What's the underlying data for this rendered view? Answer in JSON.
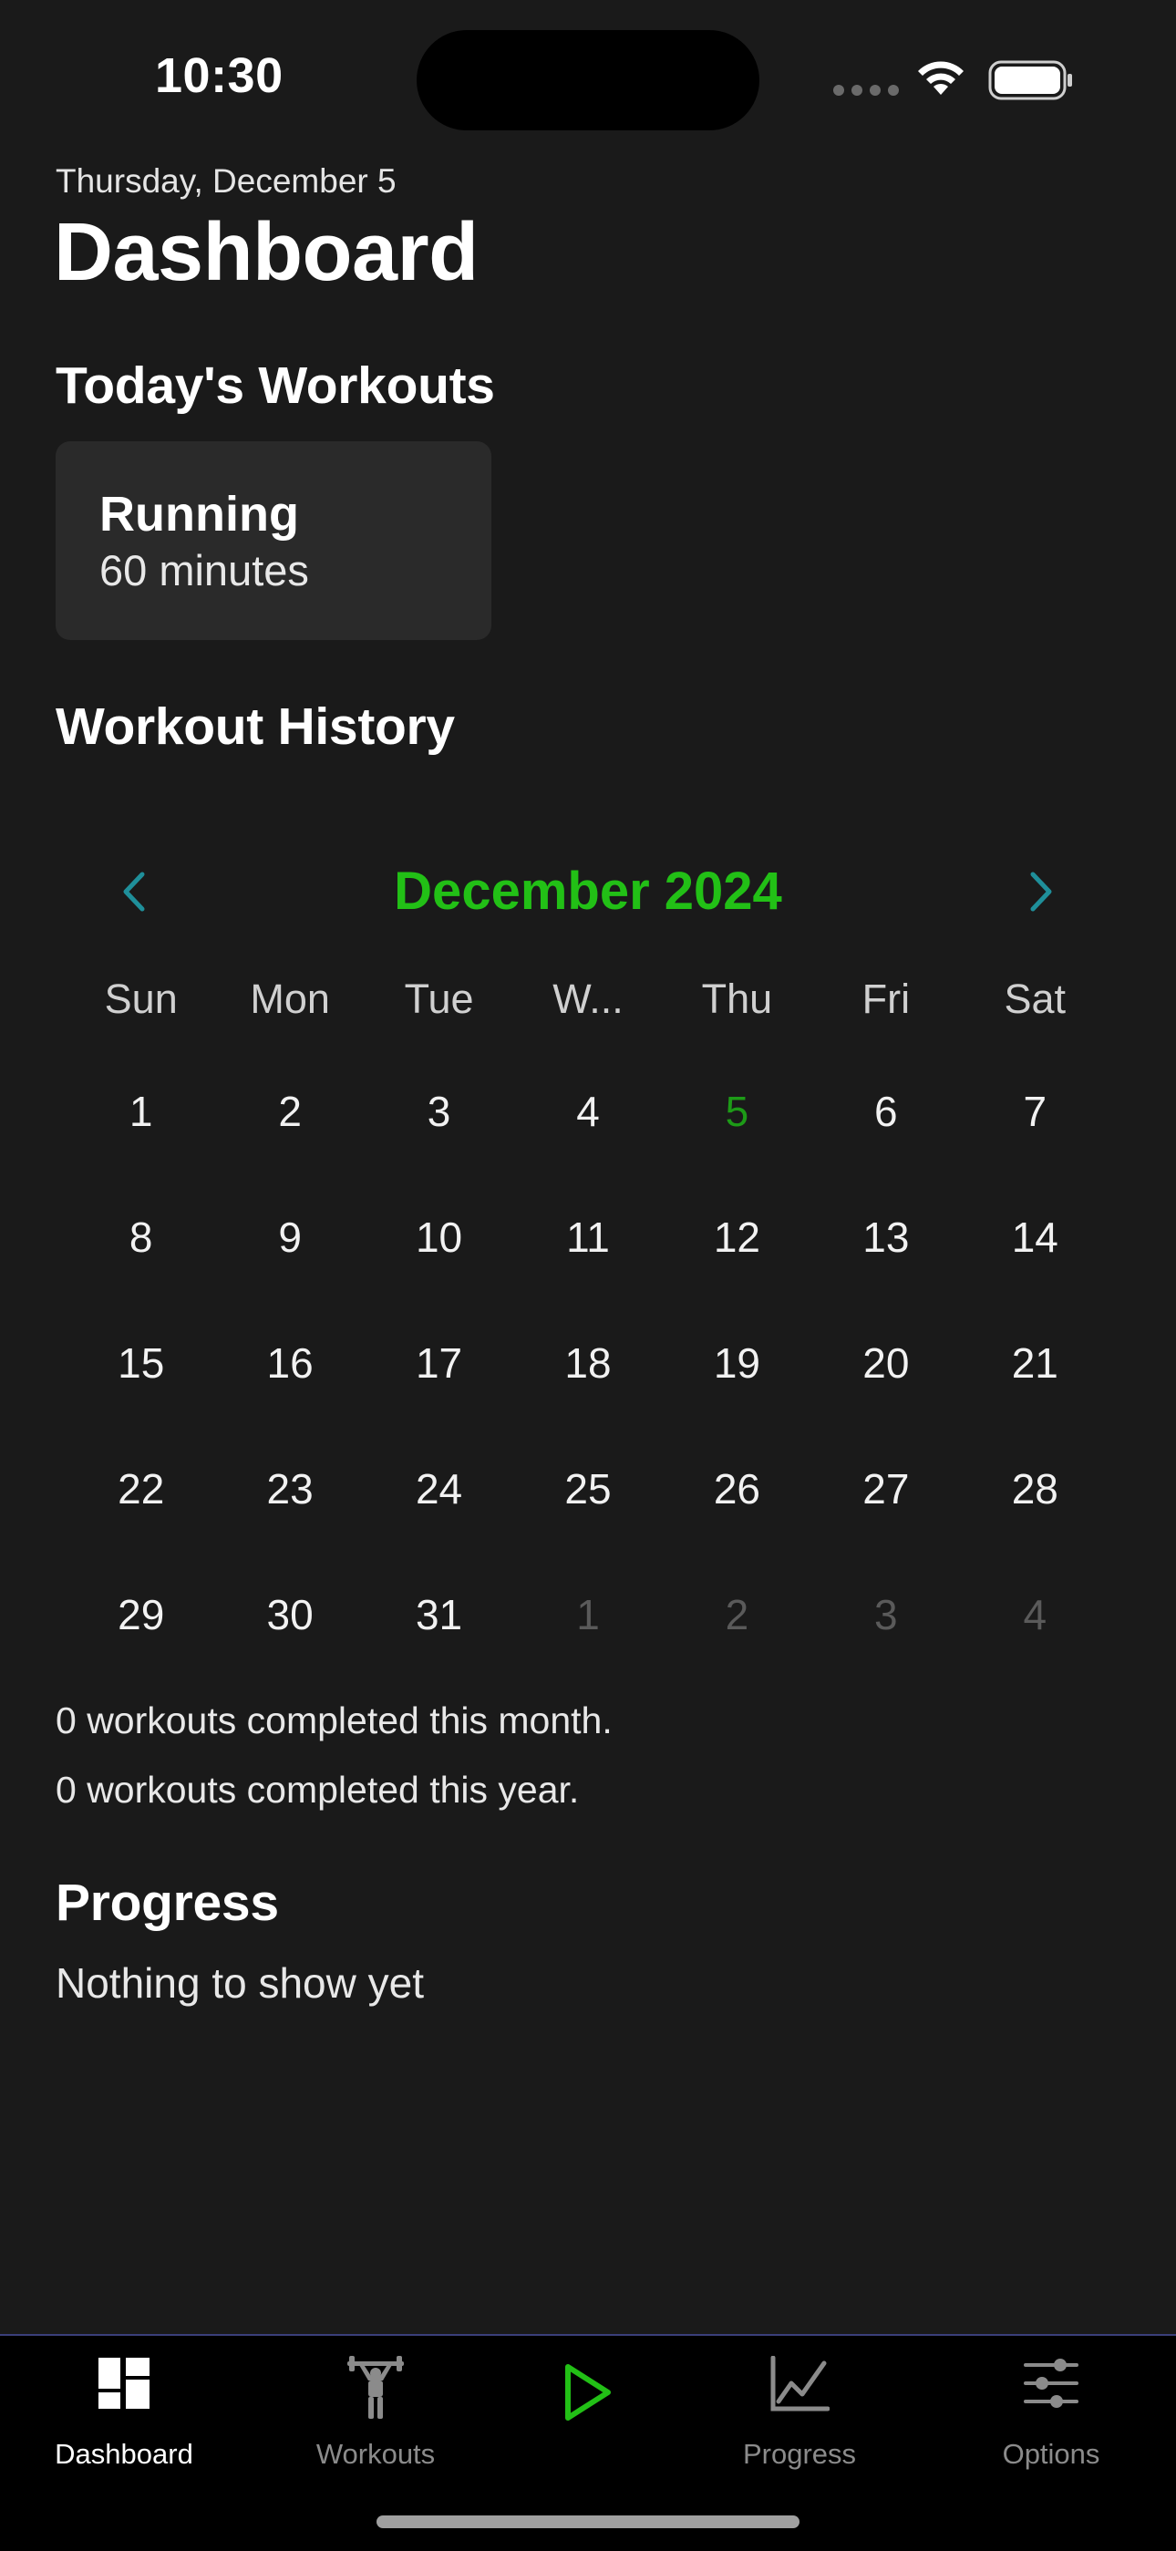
{
  "status_bar": {
    "time": "10:30"
  },
  "header": {
    "date": "Thursday, December 5",
    "title": "Dashboard"
  },
  "todays_workouts": {
    "title": "Today's Workouts",
    "items": [
      {
        "name": "Running",
        "duration": "60 minutes"
      }
    ]
  },
  "workout_history": {
    "title": "Workout History",
    "calendar": {
      "month_label": "December 2024",
      "weekdays": [
        "Sun",
        "Mon",
        "Tue",
        "W...",
        "Thu",
        "Fri",
        "Sat"
      ],
      "days": [
        {
          "label": "1"
        },
        {
          "label": "2"
        },
        {
          "label": "3"
        },
        {
          "label": "4"
        },
        {
          "label": "5",
          "today": true
        },
        {
          "label": "6"
        },
        {
          "label": "7"
        },
        {
          "label": "8"
        },
        {
          "label": "9"
        },
        {
          "label": "10"
        },
        {
          "label": "11"
        },
        {
          "label": "12"
        },
        {
          "label": "13"
        },
        {
          "label": "14"
        },
        {
          "label": "15"
        },
        {
          "label": "16"
        },
        {
          "label": "17"
        },
        {
          "label": "18"
        },
        {
          "label": "19"
        },
        {
          "label": "20"
        },
        {
          "label": "21"
        },
        {
          "label": "22"
        },
        {
          "label": "23"
        },
        {
          "label": "24"
        },
        {
          "label": "25"
        },
        {
          "label": "26"
        },
        {
          "label": "27"
        },
        {
          "label": "28"
        },
        {
          "label": "29"
        },
        {
          "label": "30"
        },
        {
          "label": "31"
        },
        {
          "label": "1",
          "muted": true
        },
        {
          "label": "2",
          "muted": true
        },
        {
          "label": "3",
          "muted": true
        },
        {
          "label": "4",
          "muted": true
        }
      ]
    },
    "stats": {
      "month": "0 workouts completed this month.",
      "year": "0 workouts completed this year."
    }
  },
  "progress": {
    "title": "Progress",
    "empty_text": "Nothing to show yet"
  },
  "tab_bar": {
    "tabs": [
      {
        "key": "dashboard",
        "label": "Dashboard",
        "icon": "dashboard-grid-icon",
        "active": true
      },
      {
        "key": "workouts",
        "label": "Workouts",
        "icon": "weightlifter-icon"
      },
      {
        "key": "start",
        "label": "",
        "icon": "play-icon"
      },
      {
        "key": "progress",
        "label": "Progress",
        "icon": "line-chart-icon"
      },
      {
        "key": "options",
        "label": "Options",
        "icon": "sliders-icon"
      }
    ]
  },
  "colors": {
    "background": "#1a1a1a",
    "accent_green": "#22c016",
    "today_green": "#1d9b17",
    "nav_chevron": "#1f8f9a",
    "card": "#2a2a2a",
    "tab_bar": "#000000"
  }
}
